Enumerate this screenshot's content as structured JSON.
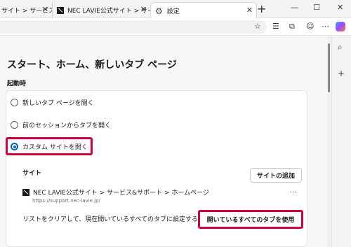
{
  "tabs": [
    {
      "label": "サイト > サービス&"
    },
    {
      "label": "NEC LAVIE公式サイト > サービス&"
    },
    {
      "label": "設定"
    }
  ],
  "page": {
    "title": "スタート、ホーム、新しいタブ ページ",
    "startup_label": "起動時",
    "options": [
      {
        "label": "新しいタブ ページを開く",
        "selected": false
      },
      {
        "label": "前のセッションからタブを開く",
        "selected": false
      },
      {
        "label": "カスタム サイトを開く",
        "selected": true
      }
    ],
    "sites_heading": "サイト",
    "add_site_button": "サイトの追加",
    "site": {
      "name": "NEC LAVIE公式サイト > サービス&サポート > ホームページ",
      "url": "https://support.nec-lavie.jp/",
      "more": "…"
    },
    "clear_text": "リストをクリアして、現在開いているすべてのタブに設定する",
    "use_open_tabs_button": "開いているすべてのタブを使用"
  },
  "colors": {
    "highlight": "#d4003b",
    "radio_selected": "#0067c0"
  }
}
